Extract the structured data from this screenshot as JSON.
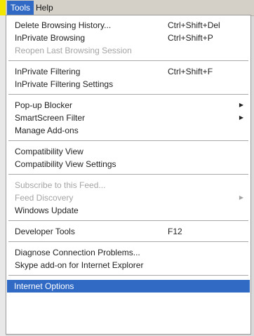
{
  "menubar": {
    "tools_label": "Tools",
    "help_label": "Help"
  },
  "menu": {
    "delete_history": {
      "label": "Delete Browsing History...",
      "shortcut": "Ctrl+Shift+Del"
    },
    "inprivate_browsing": {
      "label": "InPrivate Browsing",
      "shortcut": "Ctrl+Shift+P"
    },
    "reopen_session": {
      "label": "Reopen Last Browsing Session"
    },
    "inprivate_filtering": {
      "label": "InPrivate Filtering",
      "shortcut": "Ctrl+Shift+F"
    },
    "inprivate_filtering_settings": {
      "label": "InPrivate Filtering Settings"
    },
    "popup_blocker": {
      "label": "Pop-up Blocker"
    },
    "smartscreen_filter": {
      "label": "SmartScreen Filter"
    },
    "manage_addons": {
      "label": "Manage Add-ons"
    },
    "compatibility_view": {
      "label": "Compatibility View"
    },
    "compatibility_view_settings": {
      "label": "Compatibility View Settings"
    },
    "subscribe_feed": {
      "label": "Subscribe to this Feed..."
    },
    "feed_discovery": {
      "label": "Feed Discovery"
    },
    "windows_update": {
      "label": "Windows Update"
    },
    "developer_tools": {
      "label": "Developer Tools",
      "shortcut": "F12"
    },
    "diagnose_connection": {
      "label": "Diagnose Connection Problems..."
    },
    "skype_addon": {
      "label": "Skype add-on for Internet Explorer"
    },
    "internet_options": {
      "label": "Internet Options"
    }
  },
  "icons": {
    "submenu_arrow": "submenu-arrow-icon"
  },
  "colors": {
    "highlight": "#316ac5",
    "disabled_text": "#a4a4a4",
    "menubar_bg": "#d4d0c8"
  }
}
